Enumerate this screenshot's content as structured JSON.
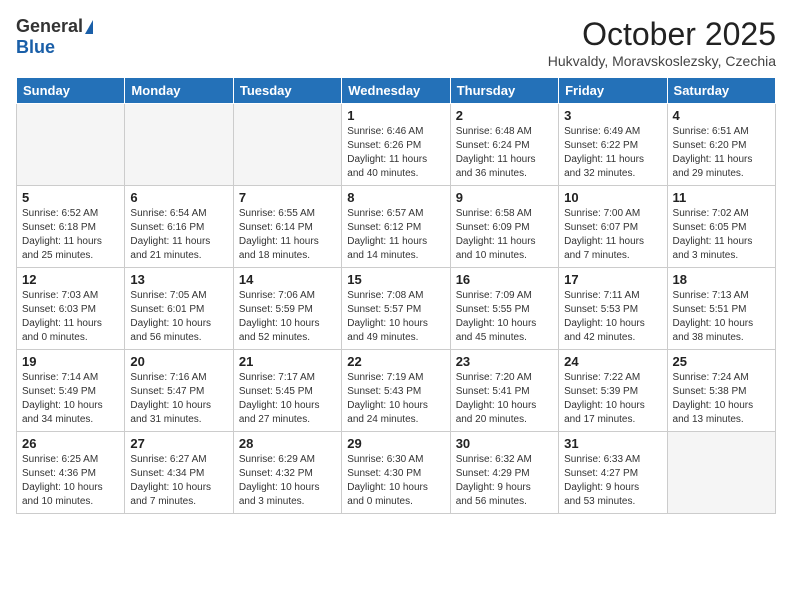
{
  "header": {
    "logo_general": "General",
    "logo_blue": "Blue",
    "month_title": "October 2025",
    "location": "Hukvaldy, Moravskoslezsky, Czechia"
  },
  "weekdays": [
    "Sunday",
    "Monday",
    "Tuesday",
    "Wednesday",
    "Thursday",
    "Friday",
    "Saturday"
  ],
  "weeks": [
    [
      {
        "day": "",
        "info": ""
      },
      {
        "day": "",
        "info": ""
      },
      {
        "day": "",
        "info": ""
      },
      {
        "day": "1",
        "info": "Sunrise: 6:46 AM\nSunset: 6:26 PM\nDaylight: 11 hours\nand 40 minutes."
      },
      {
        "day": "2",
        "info": "Sunrise: 6:48 AM\nSunset: 6:24 PM\nDaylight: 11 hours\nand 36 minutes."
      },
      {
        "day": "3",
        "info": "Sunrise: 6:49 AM\nSunset: 6:22 PM\nDaylight: 11 hours\nand 32 minutes."
      },
      {
        "day": "4",
        "info": "Sunrise: 6:51 AM\nSunset: 6:20 PM\nDaylight: 11 hours\nand 29 minutes."
      }
    ],
    [
      {
        "day": "5",
        "info": "Sunrise: 6:52 AM\nSunset: 6:18 PM\nDaylight: 11 hours\nand 25 minutes."
      },
      {
        "day": "6",
        "info": "Sunrise: 6:54 AM\nSunset: 6:16 PM\nDaylight: 11 hours\nand 21 minutes."
      },
      {
        "day": "7",
        "info": "Sunrise: 6:55 AM\nSunset: 6:14 PM\nDaylight: 11 hours\nand 18 minutes."
      },
      {
        "day": "8",
        "info": "Sunrise: 6:57 AM\nSunset: 6:12 PM\nDaylight: 11 hours\nand 14 minutes."
      },
      {
        "day": "9",
        "info": "Sunrise: 6:58 AM\nSunset: 6:09 PM\nDaylight: 11 hours\nand 10 minutes."
      },
      {
        "day": "10",
        "info": "Sunrise: 7:00 AM\nSunset: 6:07 PM\nDaylight: 11 hours\nand 7 minutes."
      },
      {
        "day": "11",
        "info": "Sunrise: 7:02 AM\nSunset: 6:05 PM\nDaylight: 11 hours\nand 3 minutes."
      }
    ],
    [
      {
        "day": "12",
        "info": "Sunrise: 7:03 AM\nSunset: 6:03 PM\nDaylight: 11 hours\nand 0 minutes."
      },
      {
        "day": "13",
        "info": "Sunrise: 7:05 AM\nSunset: 6:01 PM\nDaylight: 10 hours\nand 56 minutes."
      },
      {
        "day": "14",
        "info": "Sunrise: 7:06 AM\nSunset: 5:59 PM\nDaylight: 10 hours\nand 52 minutes."
      },
      {
        "day": "15",
        "info": "Sunrise: 7:08 AM\nSunset: 5:57 PM\nDaylight: 10 hours\nand 49 minutes."
      },
      {
        "day": "16",
        "info": "Sunrise: 7:09 AM\nSunset: 5:55 PM\nDaylight: 10 hours\nand 45 minutes."
      },
      {
        "day": "17",
        "info": "Sunrise: 7:11 AM\nSunset: 5:53 PM\nDaylight: 10 hours\nand 42 minutes."
      },
      {
        "day": "18",
        "info": "Sunrise: 7:13 AM\nSunset: 5:51 PM\nDaylight: 10 hours\nand 38 minutes."
      }
    ],
    [
      {
        "day": "19",
        "info": "Sunrise: 7:14 AM\nSunset: 5:49 PM\nDaylight: 10 hours\nand 34 minutes."
      },
      {
        "day": "20",
        "info": "Sunrise: 7:16 AM\nSunset: 5:47 PM\nDaylight: 10 hours\nand 31 minutes."
      },
      {
        "day": "21",
        "info": "Sunrise: 7:17 AM\nSunset: 5:45 PM\nDaylight: 10 hours\nand 27 minutes."
      },
      {
        "day": "22",
        "info": "Sunrise: 7:19 AM\nSunset: 5:43 PM\nDaylight: 10 hours\nand 24 minutes."
      },
      {
        "day": "23",
        "info": "Sunrise: 7:20 AM\nSunset: 5:41 PM\nDaylight: 10 hours\nand 20 minutes."
      },
      {
        "day": "24",
        "info": "Sunrise: 7:22 AM\nSunset: 5:39 PM\nDaylight: 10 hours\nand 17 minutes."
      },
      {
        "day": "25",
        "info": "Sunrise: 7:24 AM\nSunset: 5:38 PM\nDaylight: 10 hours\nand 13 minutes."
      }
    ],
    [
      {
        "day": "26",
        "info": "Sunrise: 6:25 AM\nSunset: 4:36 PM\nDaylight: 10 hours\nand 10 minutes."
      },
      {
        "day": "27",
        "info": "Sunrise: 6:27 AM\nSunset: 4:34 PM\nDaylight: 10 hours\nand 7 minutes."
      },
      {
        "day": "28",
        "info": "Sunrise: 6:29 AM\nSunset: 4:32 PM\nDaylight: 10 hours\nand 3 minutes."
      },
      {
        "day": "29",
        "info": "Sunrise: 6:30 AM\nSunset: 4:30 PM\nDaylight: 10 hours\nand 0 minutes."
      },
      {
        "day": "30",
        "info": "Sunrise: 6:32 AM\nSunset: 4:29 PM\nDaylight: 9 hours\nand 56 minutes."
      },
      {
        "day": "31",
        "info": "Sunrise: 6:33 AM\nSunset: 4:27 PM\nDaylight: 9 hours\nand 53 minutes."
      },
      {
        "day": "",
        "info": ""
      }
    ]
  ]
}
